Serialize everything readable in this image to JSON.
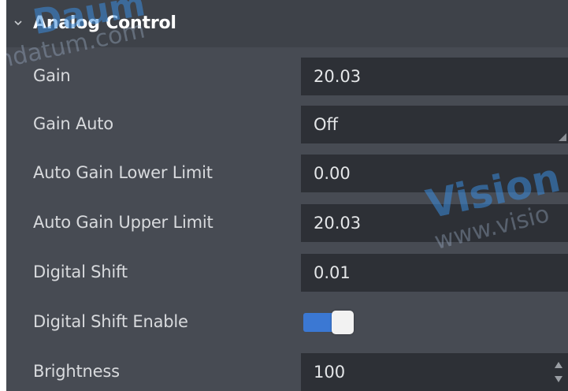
{
  "section": {
    "title": "Analog Control",
    "expand_icon": "chevron-down-icon"
  },
  "rows": [
    {
      "label": "Gain",
      "value": "20.03",
      "control": "input"
    },
    {
      "label": "Gain Auto",
      "value": "Off",
      "control": "dropdown"
    },
    {
      "label": "Auto Gain Lower Limit",
      "value": "0.00",
      "control": "input"
    },
    {
      "label": "Auto Gain Upper Limit",
      "value": "20.03",
      "control": "input"
    },
    {
      "label": "Digital Shift",
      "value": "0.01",
      "control": "input"
    },
    {
      "label": "Digital Shift Enable",
      "value": "on",
      "control": "toggle"
    },
    {
      "label": "Brightness",
      "value": "100",
      "control": "spinbox"
    }
  ],
  "watermarks": {
    "top_left_main": "Daum",
    "top_left_sub": "ndatum.com",
    "right_main": "Vision",
    "right_sub": "www.visio"
  },
  "colors": {
    "panel_bg": "#474b53",
    "header_bg": "#3e4249",
    "field_bg": "#2d3036",
    "toggle_on": "#3b78d3",
    "text": "#d8dadd"
  }
}
